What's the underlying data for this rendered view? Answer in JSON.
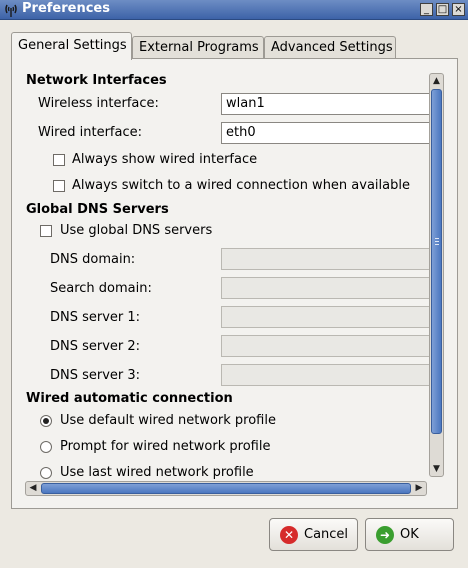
{
  "window": {
    "title": "Preferences",
    "controls": {
      "minimize": "_",
      "maximize": "□",
      "close": "×"
    }
  },
  "tabs": [
    {
      "label": "General Settings",
      "active": true
    },
    {
      "label": "External Programs",
      "active": false
    },
    {
      "label": "Advanced Settings",
      "active": false
    }
  ],
  "network_interfaces": {
    "heading": "Network Interfaces",
    "wireless_label": "Wireless interface:",
    "wireless_value": "wlan1",
    "wired_label": "Wired interface:",
    "wired_value": "eth0",
    "always_show_wired": {
      "label": "Always show wired interface",
      "checked": false
    },
    "always_switch_wired": {
      "label": "Always switch to a wired connection when available",
      "checked": false
    }
  },
  "global_dns": {
    "heading": "Global DNS Servers",
    "use_global": {
      "label": "Use global DNS servers",
      "checked": false
    },
    "dns_domain_label": "DNS domain:",
    "search_domain_label": "Search domain:",
    "dns_server_1_label": "DNS server 1:",
    "dns_server_2_label": "DNS server 2:",
    "dns_server_3_label": "DNS server 3:"
  },
  "wired_auto": {
    "heading": "Wired automatic connection",
    "options": [
      {
        "label": "Use default wired network profile",
        "selected": true
      },
      {
        "label": "Prompt for wired network profile",
        "selected": false
      },
      {
        "label": "Use last wired network profile",
        "selected": false
      }
    ]
  },
  "buttons": {
    "cancel": {
      "label": "Cancel",
      "icon": "cancel-icon",
      "color": "#d62b2b"
    },
    "ok": {
      "label": "OK",
      "icon": "ok-arrow-icon",
      "color": "#3a9e2f"
    }
  },
  "colors": {
    "titlebar": "#4a6fb0",
    "scroll_thumb": "#5b85c8"
  }
}
